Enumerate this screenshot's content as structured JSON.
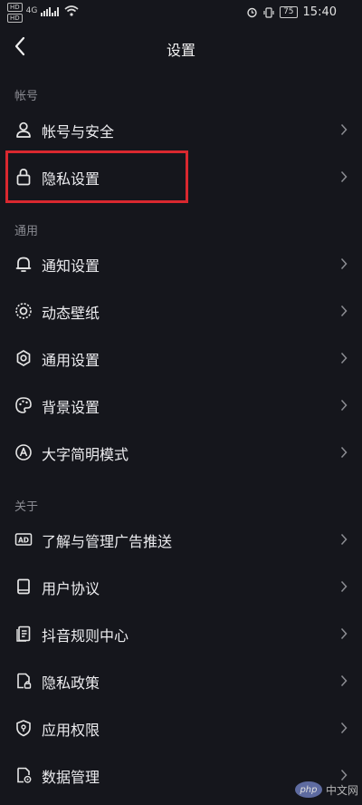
{
  "status_bar": {
    "hd_1": "HD",
    "hd_2": "HD",
    "signal": "4G",
    "battery": "75",
    "time": "15:40"
  },
  "header": {
    "title": "设置"
  },
  "sections": {
    "account": {
      "label": "帐号",
      "items": [
        {
          "label": "帐号与安全",
          "icon": "person-icon"
        },
        {
          "label": "隐私设置",
          "icon": "lock-icon"
        }
      ]
    },
    "general": {
      "label": "通用",
      "items": [
        {
          "label": "通知设置",
          "icon": "bell-icon"
        },
        {
          "label": "动态壁纸",
          "icon": "sparkle-ring-icon"
        },
        {
          "label": "通用设置",
          "icon": "gear-icon"
        },
        {
          "label": "背景设置",
          "icon": "palette-icon"
        },
        {
          "label": "大字简明模式",
          "icon": "text-a-icon"
        }
      ]
    },
    "about": {
      "label": "关于",
      "items": [
        {
          "label": "了解与管理广告推送",
          "icon": "ad-icon"
        },
        {
          "label": "用户协议",
          "icon": "book-icon"
        },
        {
          "label": "抖音规则中心",
          "icon": "document-icon"
        },
        {
          "label": "隐私政策",
          "icon": "privacy-doc-icon"
        },
        {
          "label": "应用权限",
          "icon": "shield-icon"
        },
        {
          "label": "数据管理",
          "icon": "data-doc-icon"
        }
      ]
    }
  },
  "highlight_color": "#d9282f",
  "watermark": {
    "logo": "php",
    "text": "中文网"
  }
}
